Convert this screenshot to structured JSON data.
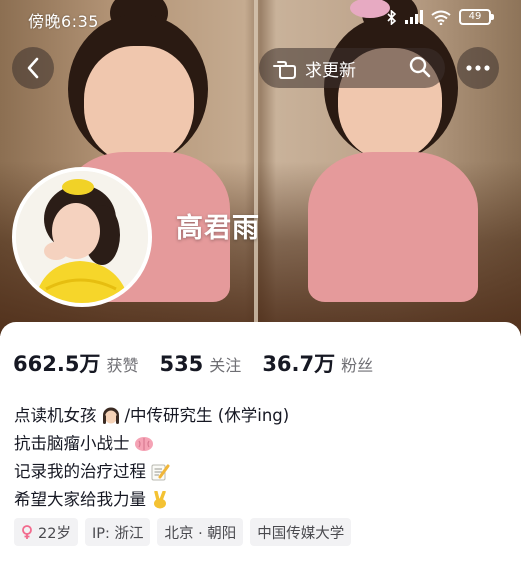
{
  "status_bar": {
    "time": "傍晚6:35",
    "battery": "49"
  },
  "nav": {
    "update_label": "求更新"
  },
  "profile": {
    "name": "高君雨"
  },
  "stats": [
    {
      "value": "662.5万",
      "label": "获赞"
    },
    {
      "value": "535",
      "label": "关注"
    },
    {
      "value": "36.7万",
      "label": "粉丝"
    }
  ],
  "bio": {
    "line1_a": "点读机女孩",
    "line1_b": "/中传研究生 (休学ing)",
    "line2": "抗击脑瘤小战士",
    "line3": "记录我的治疗过程",
    "line4": "希望大家给我力量"
  },
  "tags": {
    "age": "22岁",
    "ip": "IP: 浙江",
    "location": "北京 · 朝阳",
    "school": "中国传媒大学"
  },
  "icons": {
    "back": "chevron-left-icon",
    "update": "hand-point-icon",
    "search": "search-icon",
    "more": "more-dots-icon",
    "gender": "female-icon"
  }
}
